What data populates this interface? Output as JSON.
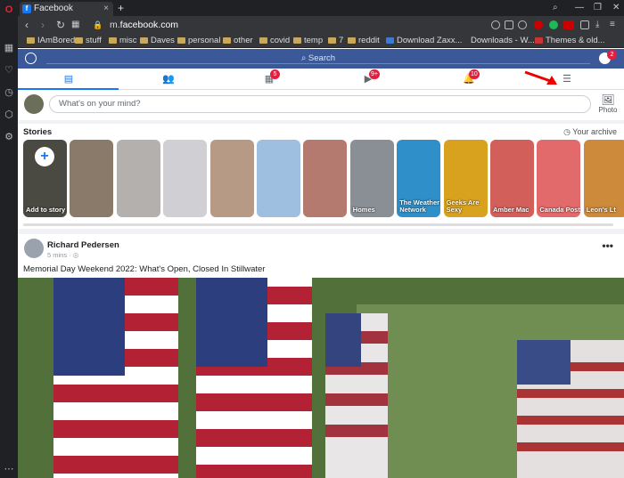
{
  "browser": {
    "tab_title": "Facebook",
    "tab_close": "×",
    "new_tab": "+",
    "url_prefix": "m.",
    "url_domain": "facebook.com",
    "bookmarks": [
      "IAmBored",
      "stuff",
      "misc",
      "Daves",
      "personal",
      "other",
      "covid",
      "temp",
      "7",
      "reddit",
      "Download Zaxx...",
      "Downloads - W...",
      "Themes & old..."
    ]
  },
  "fb": {
    "search_placeholder": "Search",
    "badges": {
      "notifications_bubble": "2",
      "friends": "5",
      "watch": "9+",
      "bell": "10"
    },
    "whats_on_mind": "What's on your mind?",
    "photo_label": "Photo",
    "stories_title": "Stories",
    "archive_label": "Your archive",
    "stories": [
      {
        "label": "Add to story",
        "color": "#4a4a42"
      },
      {
        "label": "",
        "color": "#8a7a6a"
      },
      {
        "label": "",
        "color": "#b3b0ae"
      },
      {
        "label": "",
        "color": "#d0cfd4"
      },
      {
        "label": "",
        "color": "#b69a86"
      },
      {
        "label": "",
        "color": "#9fbfe0"
      },
      {
        "label": "",
        "color": "#b47a70"
      },
      {
        "label": "Homes",
        "color": "#8a8f96"
      },
      {
        "label": "The Weather Network",
        "color": "#2e8fc9"
      },
      {
        "label": "Geeks Are Sexy",
        "color": "#d9a21e"
      },
      {
        "label": "Amber Mac",
        "color": "#d35f5a"
      },
      {
        "label": "Canada Post",
        "color": "#e26a6a"
      },
      {
        "label": "Leon's Lt",
        "color": "#cc8a3a"
      }
    ],
    "post": {
      "author": "Richard Pedersen",
      "time": "5 mins · ◎",
      "text": "Memorial Day Weekend 2022: What's Open, Closed In Stillwater",
      "more": "•••"
    }
  },
  "colors": {
    "fb_blue": "#3b5998",
    "badge_red": "#e41e3f"
  }
}
